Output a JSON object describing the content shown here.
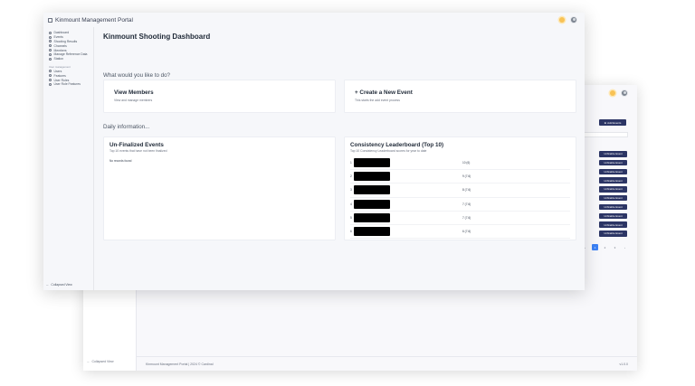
{
  "back_window": {
    "add_button_label": "Add Events",
    "unfinalize_label": "Unfinalize Event",
    "unfinalize_count": 10,
    "pagination": {
      "prev": "‹",
      "pages": [
        "1",
        "2",
        "3"
      ],
      "active": "1",
      "next": "›"
    },
    "collapse_label": "Collapsed View",
    "footer_left": "Kinmount Management Portal | 2024 © Cardinal",
    "footer_right": "v1.0.0"
  },
  "front_window": {
    "app_title": "Kinmount Management Portal",
    "sidebar": {
      "items": [
        {
          "label": "Dashboard",
          "icon": "dashboard-icon"
        },
        {
          "label": "Events",
          "icon": "calendar-icon"
        },
        {
          "label": "Shooting Results",
          "icon": "target-icon"
        },
        {
          "label": "Channels",
          "icon": "channel-icon"
        },
        {
          "label": "Members",
          "icon": "users-icon"
        },
        {
          "label": "Manage Reference Data",
          "icon": "database-icon"
        },
        {
          "label": "Station",
          "icon": "station-icon"
        }
      ],
      "group_label": "User management",
      "group_items": [
        {
          "label": "Users",
          "icon": "user-icon"
        },
        {
          "label": "Features",
          "icon": "feature-icon"
        },
        {
          "label": "User Roles",
          "icon": "role-icon"
        },
        {
          "label": "User Role Features",
          "icon": "role-feature-icon"
        }
      ],
      "collapse_label": "Collapsed View"
    },
    "page_title": "Kinmount Shooting Dashboard",
    "question": "What would you like to do?",
    "actions": [
      {
        "title": "View Members",
        "subtitle": "View and manage members"
      },
      {
        "title": "+ Create a New Event",
        "subtitle": "This starts the add event process"
      }
    ],
    "daily_label": "Daily information...",
    "unfinalized": {
      "title": "Un-Finalized Events",
      "subtitle": "Top 10 events that have not been finalized",
      "empty": "No records found"
    },
    "leaderboard": {
      "title": "Consistency Leaderboard (Top 10)",
      "subtitle": "Top 10 Consistency Leaderboard scores for year to date",
      "rows": [
        {
          "rank": "1",
          "score": "10 (6)"
        },
        {
          "rank": "2",
          "score": "9 (7.6)"
        },
        {
          "rank": "3",
          "score": "8 (7.6)"
        },
        {
          "rank": "4",
          "score": "7 (7.6)"
        },
        {
          "rank": "5",
          "score": "7 (7.6)"
        },
        {
          "rank": "6",
          "score": "6 (7.6)"
        }
      ]
    }
  }
}
